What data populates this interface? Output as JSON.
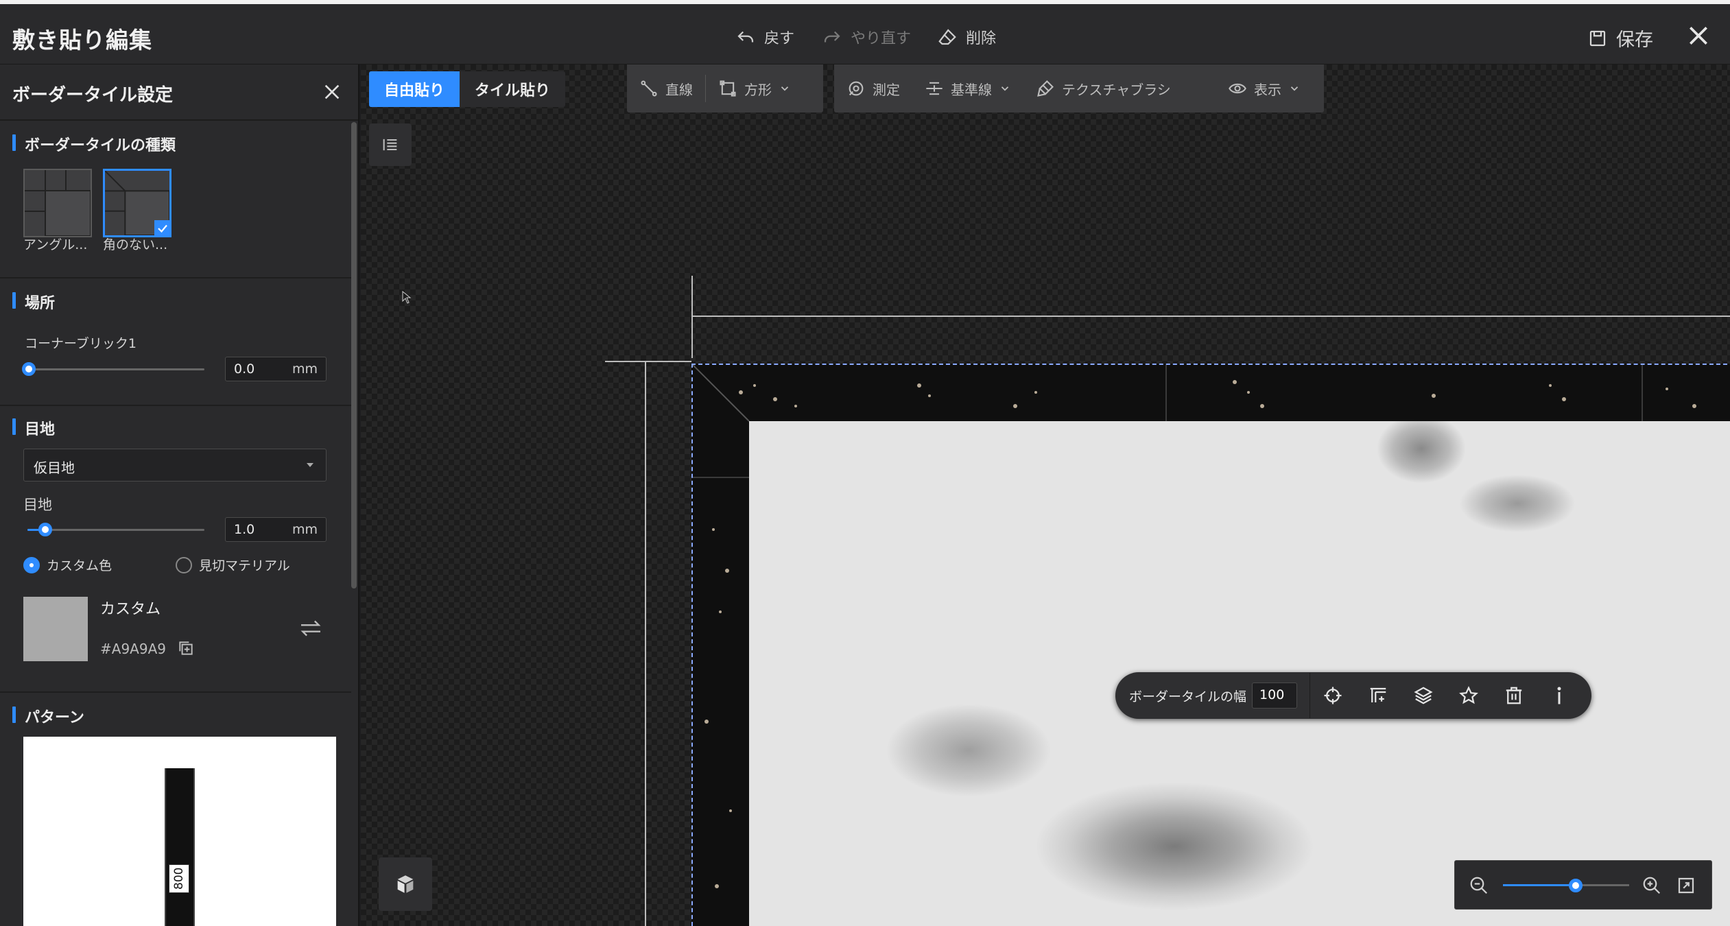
{
  "app": {
    "title": "敷き貼り編集"
  },
  "toolbar": {
    "undo": "戻す",
    "redo": "やり直す",
    "delete": "削除",
    "save": "保存"
  },
  "panel": {
    "title": "ボーダータイル設定",
    "type_section": "ボーダータイルの種類",
    "type_options": [
      {
        "label": "アングル..."
      },
      {
        "label": "角のない..."
      }
    ],
    "location_section": "場所",
    "corner_label": "コーナーブリック1",
    "corner_value": "0.0",
    "unit": "mm",
    "joint_section": "目地",
    "joint_select": "仮目地",
    "joint_label": "目地",
    "joint_value": "1.0",
    "radio_custom": "カスタム色",
    "radio_material": "見切マテリアル",
    "color_name": "カスタム",
    "color_hex": "#A9A9A9",
    "pattern_section": "パターン",
    "pattern_dim": "800"
  },
  "canvas": {
    "mode_free": "自由貼り",
    "mode_tile": "タイル貼り",
    "tools": {
      "line": "直線",
      "rect": "方形",
      "measure": "測定",
      "guide": "基準線",
      "texture": "テクスチャブラシ",
      "view": "表示"
    },
    "float_toolbar": {
      "width_label": "ボーダータイルの幅",
      "width_value": "100"
    }
  },
  "colors": {
    "accent": "#2f8cff",
    "swatch": "#A9A9A9"
  }
}
